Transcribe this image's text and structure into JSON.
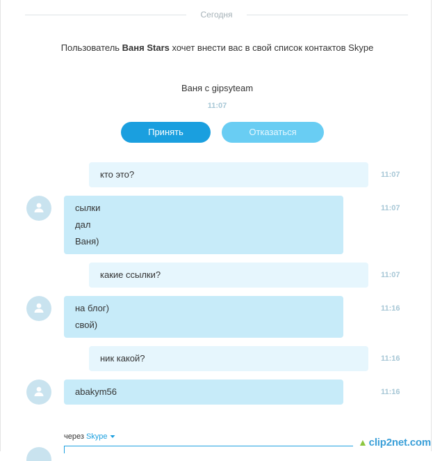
{
  "date_separator": "Сегодня",
  "contact_request": {
    "text_before": "Пользователь ",
    "user": "Ваня Stars",
    "text_after": " хочет внести вас в свой список контактов Skype",
    "greeting": "Ваня с gipsyteam",
    "time": "11:07",
    "accept_label": "Принять",
    "decline_label": "Отказаться"
  },
  "messages": [
    {
      "dir": "out",
      "lines": [
        "кто это?"
      ],
      "time": "11:07"
    },
    {
      "dir": "in",
      "lines": [
        "сылки",
        "дал",
        "Ваня)"
      ],
      "time": "11:07"
    },
    {
      "dir": "out",
      "lines": [
        "какие ссылки?"
      ],
      "time": "11:07"
    },
    {
      "dir": "in",
      "lines": [
        "на блог)",
        "свой)"
      ],
      "time": "11:16"
    },
    {
      "dir": "out",
      "lines": [
        "ник какой?"
      ],
      "time": "11:16"
    },
    {
      "dir": "in",
      "lines": [
        "abakym56"
      ],
      "time": "11:16"
    }
  ],
  "composer": {
    "via_label": "через",
    "service": "Skype"
  },
  "watermark": "clip2net.com",
  "colors": {
    "accent": "#1a9fdf",
    "outgoing_bubble": "#e6f6fd",
    "incoming_bubble": "#c7ebf9",
    "timestamp": "#a7c7d6"
  }
}
